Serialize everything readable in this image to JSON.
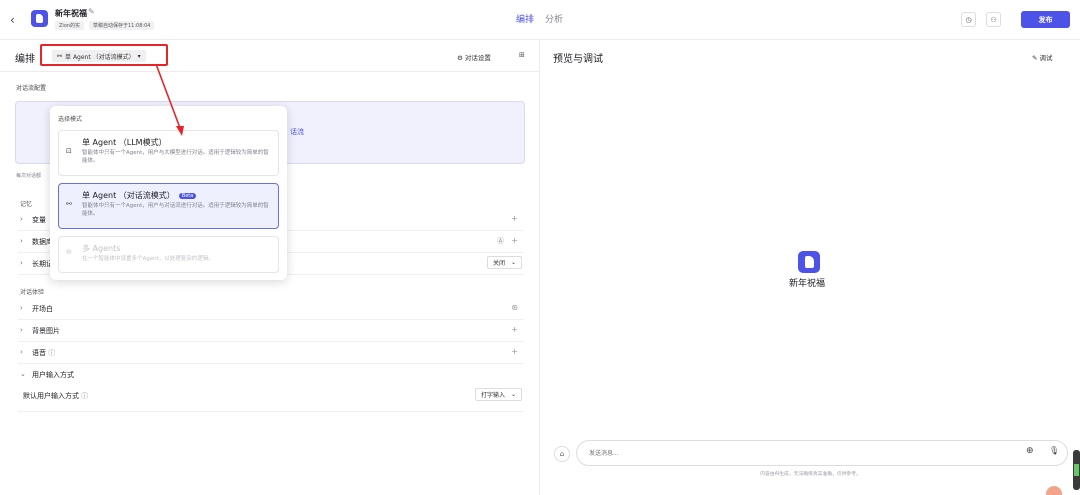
{
  "topbar": {
    "back_icon": "chevron-left-icon",
    "app_name": "新年祝福",
    "space_tag": "Zion的实",
    "save_status": "草稿自动保存于11:08:04",
    "tabs": [
      {
        "label": "编排",
        "active": true
      },
      {
        "label": "分析",
        "active": false
      }
    ],
    "history_icon": "clock-icon",
    "collab_icon": "users-icon",
    "publish_label": "发布",
    "accent_color": "#4d53e8"
  },
  "left": {
    "title": "编排",
    "mode_selected": "单 Agent （对话流模式）",
    "dialog_settings_label": "对话设置",
    "conf_label": "对话流配置",
    "flow_box_text": "话流",
    "each_label": "每次对话都",
    "memory_section": "记忆",
    "memory_rows": [
      {
        "label": "变量"
      },
      {
        "label": "数据库"
      },
      {
        "label": "长期记忆",
        "select": "关闭"
      }
    ],
    "experience_section": "对话体验",
    "experience_rows": [
      {
        "label": "开场白"
      },
      {
        "label": "背景图片"
      },
      {
        "label": "语音"
      },
      {
        "label": "用户输入方式"
      }
    ],
    "default_input": {
      "label": "默认用户输入方式",
      "value": "打字输入"
    }
  },
  "popup": {
    "title": "选择模式",
    "options": [
      {
        "title": "单 Agent （LLM模式）",
        "desc": "智能体中只有一个Agent，用户与大模型进行对话。适用于逻辑较为简单的智能体。",
        "enabled": true
      },
      {
        "title": "单 Agent （对话流模式）",
        "badge": "Beta",
        "desc": "智能体中只有一个Agent，用户与对话流进行对话。适用于逻辑较为简单的智能体。",
        "enabled": true,
        "selected": true
      },
      {
        "title": "多 Agents",
        "desc": "在一个智能体中设置多个Agent，以处理复杂的逻辑。",
        "enabled": false
      }
    ],
    "highlight_color": "#e8242b"
  },
  "right": {
    "title": "预览与调试",
    "debug_label": "调试",
    "bot_name": "新年祝福",
    "input_placeholder": "发送消息...",
    "disclaimer": "内容由AI生成，无法确保真实准确，仅供参考。"
  }
}
